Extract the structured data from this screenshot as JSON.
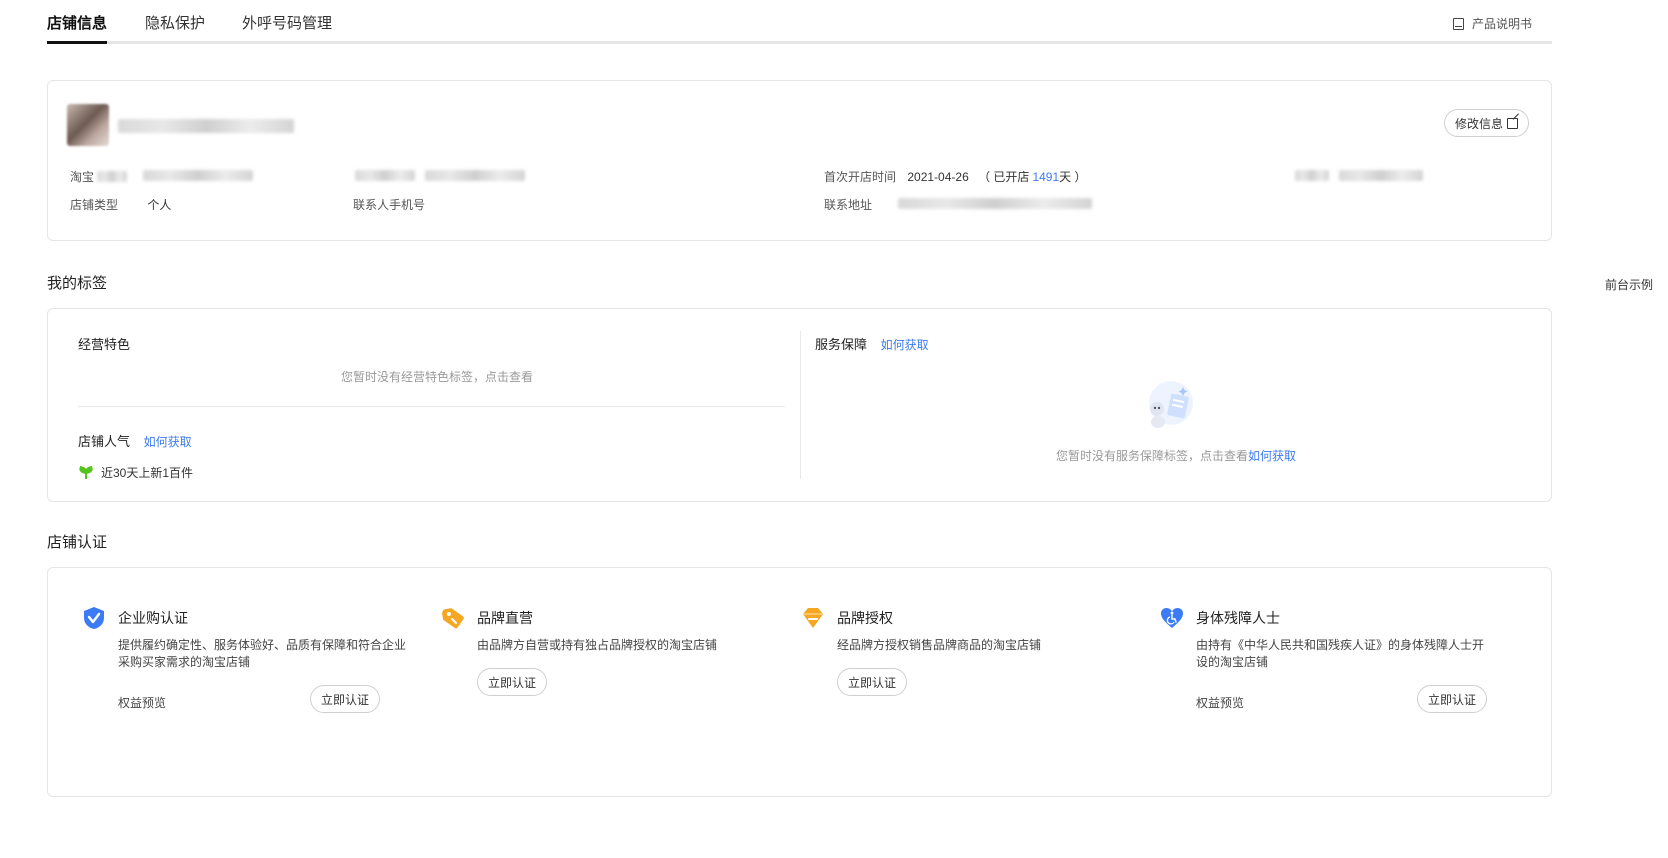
{
  "tabs": [
    {
      "label": "店铺信息",
      "active": true
    },
    {
      "label": "隐私保护",
      "active": false
    },
    {
      "label": "外呼号码管理",
      "active": false
    }
  ],
  "manual_label": "产品说明书",
  "store": {
    "edit_label": "修改信息",
    "taobao_label": "淘宝",
    "type_label": "店铺类型",
    "type_value": "个人",
    "contact_phone_label": "联系人手机号",
    "first_open_label": "首次开店时间",
    "first_open_date": "2021-04-26",
    "open_days_prefix": "（ 已开店",
    "open_days": "1491",
    "open_days_suffix": "天 ）",
    "address_label": "联系地址"
  },
  "tags_section": {
    "title": "我的标签",
    "right_link": "前台示例",
    "features_title": "经营特色",
    "features_empty": "您暂时没有经营特色标签，点击查看",
    "popularity_title": "店铺人气",
    "how_to_get": "如何获取",
    "popularity_item": "近30天上新1百件",
    "service_title": "服务保障",
    "service_empty": "您暂时没有服务保障标签，点击查看",
    "service_empty_link": "如何获取"
  },
  "cert_section": {
    "title": "店铺认证",
    "items": [
      {
        "title": "企业购认证",
        "desc": "提供履约确定性、服务体验好、品质有保障和符合企业采购买家需求的淘宝店铺",
        "rights": "权益预览",
        "button": "立即认证",
        "icon": "shield-check-icon",
        "color": "#3b7bf5"
      },
      {
        "title": "品牌直营",
        "desc": "由品牌方自营或持有独占品牌授权的淘宝店铺",
        "rights": "",
        "button": "立即认证",
        "icon": "tag-icon",
        "color": "#f5a623"
      },
      {
        "title": "品牌授权",
        "desc": "经品牌方授权销售品牌商品的淘宝店铺",
        "rights": "",
        "button": "立即认证",
        "icon": "diamond-icon",
        "color": "#f5a623"
      },
      {
        "title": "身体残障人士",
        "desc": "由持有《中华人民共和国残疾人证》的身体残障人士开设的淘宝店铺",
        "rights": "权益预览",
        "button": "立即认证",
        "icon": "heart-wheelchair-icon",
        "color": "#3b7bf5"
      }
    ]
  }
}
